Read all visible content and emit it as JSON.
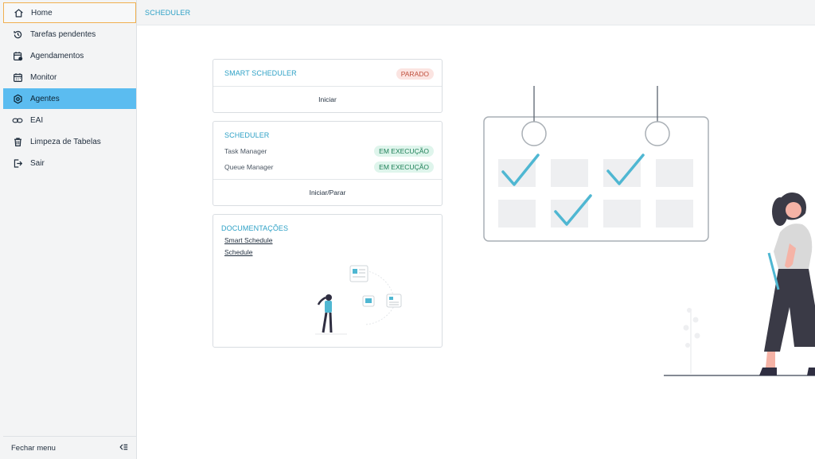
{
  "sidebar": {
    "items": [
      {
        "label": "Home",
        "icon": "home-icon"
      },
      {
        "label": "Tarefas pendentes",
        "icon": "history-icon"
      },
      {
        "label": "Agendamentos",
        "icon": "calendar-clock-icon"
      },
      {
        "label": "Monitor",
        "icon": "calendar-icon"
      },
      {
        "label": "Agentes",
        "icon": "settings-gear-icon"
      },
      {
        "label": "EAI",
        "icon": "link-icon"
      },
      {
        "label": "Limpeza de Tabelas",
        "icon": "trash-icon"
      },
      {
        "label": "Sair",
        "icon": "logout-icon"
      }
    ],
    "footer_label": "Fechar menu",
    "active_color": "#5bbcf0"
  },
  "header": {
    "breadcrumb": "SCHEDULER"
  },
  "smart_scheduler": {
    "title": "SMART SCHEDULER",
    "status": "PARADO",
    "action": "Iniciar"
  },
  "scheduler": {
    "title": "SCHEDULER",
    "rows": [
      {
        "label": "Task Manager",
        "status": "EM EXECUÇÃO"
      },
      {
        "label": "Queue Manager",
        "status": "EM EXECUÇÃO"
      }
    ],
    "action": "Iniciar/Parar"
  },
  "docs": {
    "title": "DOCUMENTAÇÕES",
    "links": [
      "Smart Schedule",
      "Schedule"
    ]
  },
  "colors": {
    "accent": "#2ea1c6",
    "check": "#4fb7d2",
    "stopped_bg": "#fbe4e1",
    "running_bg": "#dff5ec"
  }
}
